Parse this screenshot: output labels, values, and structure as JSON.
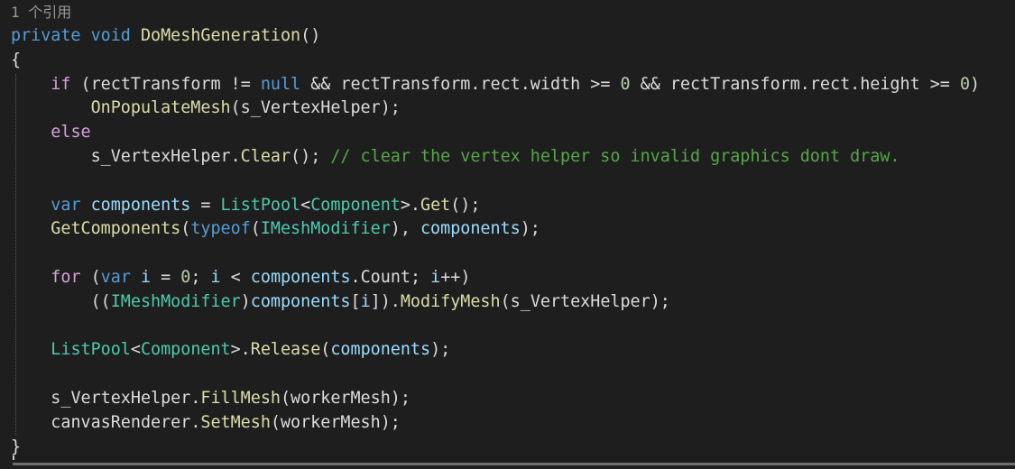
{
  "codelens": "1 个引用",
  "lines": [
    [
      {
        "text": "private",
        "c": "kw"
      },
      {
        "text": " ",
        "c": "plain"
      },
      {
        "text": "void",
        "c": "kw"
      },
      {
        "text": " ",
        "c": "plain"
      },
      {
        "text": "DoMeshGeneration",
        "c": "mth"
      },
      {
        "text": "()",
        "c": "plain"
      }
    ],
    [
      {
        "text": "{",
        "c": "plain"
      }
    ],
    [
      {
        "text": "    ",
        "c": "plain"
      },
      {
        "text": "if",
        "c": "ctl"
      },
      {
        "text": " (",
        "c": "plain"
      },
      {
        "text": "rectTransform",
        "c": "plain"
      },
      {
        "text": " != ",
        "c": "plain"
      },
      {
        "text": "null",
        "c": "kw"
      },
      {
        "text": " && ",
        "c": "plain"
      },
      {
        "text": "rectTransform.rect.width",
        "c": "plain"
      },
      {
        "text": " >= ",
        "c": "plain"
      },
      {
        "text": "0",
        "c": "num"
      },
      {
        "text": " && ",
        "c": "plain"
      },
      {
        "text": "rectTransform.rect.height",
        "c": "plain"
      },
      {
        "text": " >= ",
        "c": "plain"
      },
      {
        "text": "0",
        "c": "num"
      },
      {
        "text": ")",
        "c": "plain"
      }
    ],
    [
      {
        "text": "        ",
        "c": "plain"
      },
      {
        "text": "OnPopulateMesh",
        "c": "mth"
      },
      {
        "text": "(",
        "c": "plain"
      },
      {
        "text": "s_VertexHelper",
        "c": "plain"
      },
      {
        "text": ");",
        "c": "plain"
      }
    ],
    [
      {
        "text": "    ",
        "c": "plain"
      },
      {
        "text": "else",
        "c": "ctl"
      }
    ],
    [
      {
        "text": "        ",
        "c": "plain"
      },
      {
        "text": "s_VertexHelper",
        "c": "plain"
      },
      {
        "text": ".",
        "c": "plain"
      },
      {
        "text": "Clear",
        "c": "mth"
      },
      {
        "text": "(); ",
        "c": "plain"
      },
      {
        "text": "// clear the vertex helper so invalid graphics dont draw.",
        "c": "cmt"
      }
    ],
    [],
    [
      {
        "text": "    ",
        "c": "plain"
      },
      {
        "text": "var",
        "c": "kw"
      },
      {
        "text": " ",
        "c": "plain"
      },
      {
        "text": "components",
        "c": "id"
      },
      {
        "text": " = ",
        "c": "plain"
      },
      {
        "text": "ListPool",
        "c": "typ"
      },
      {
        "text": "<",
        "c": "plain"
      },
      {
        "text": "Component",
        "c": "typ"
      },
      {
        "text": ">.",
        "c": "plain"
      },
      {
        "text": "Get",
        "c": "mth"
      },
      {
        "text": "();",
        "c": "plain"
      }
    ],
    [
      {
        "text": "    ",
        "c": "plain"
      },
      {
        "text": "GetComponents",
        "c": "mth"
      },
      {
        "text": "(",
        "c": "plain"
      },
      {
        "text": "typeof",
        "c": "kw"
      },
      {
        "text": "(",
        "c": "plain"
      },
      {
        "text": "IMeshModifier",
        "c": "typ"
      },
      {
        "text": "), ",
        "c": "plain"
      },
      {
        "text": "components",
        "c": "id"
      },
      {
        "text": ");",
        "c": "plain"
      }
    ],
    [],
    [
      {
        "text": "    ",
        "c": "plain"
      },
      {
        "text": "for",
        "c": "ctl"
      },
      {
        "text": " (",
        "c": "plain"
      },
      {
        "text": "var",
        "c": "kw"
      },
      {
        "text": " ",
        "c": "plain"
      },
      {
        "text": "i",
        "c": "id"
      },
      {
        "text": " = ",
        "c": "plain"
      },
      {
        "text": "0",
        "c": "num"
      },
      {
        "text": "; ",
        "c": "plain"
      },
      {
        "text": "i",
        "c": "id"
      },
      {
        "text": " < ",
        "c": "plain"
      },
      {
        "text": "components",
        "c": "id"
      },
      {
        "text": ".Count; ",
        "c": "plain"
      },
      {
        "text": "i",
        "c": "id"
      },
      {
        "text": "++)",
        "c": "plain"
      }
    ],
    [
      {
        "text": "        ((",
        "c": "plain"
      },
      {
        "text": "IMeshModifier",
        "c": "typ"
      },
      {
        "text": ")",
        "c": "plain"
      },
      {
        "text": "components",
        "c": "id"
      },
      {
        "text": "[",
        "c": "plain"
      },
      {
        "text": "i",
        "c": "id"
      },
      {
        "text": "]).",
        "c": "plain"
      },
      {
        "text": "ModifyMesh",
        "c": "mth"
      },
      {
        "text": "(",
        "c": "plain"
      },
      {
        "text": "s_VertexHelper",
        "c": "plain"
      },
      {
        "text": ");",
        "c": "plain"
      }
    ],
    [],
    [
      {
        "text": "    ",
        "c": "plain"
      },
      {
        "text": "ListPool",
        "c": "typ"
      },
      {
        "text": "<",
        "c": "plain"
      },
      {
        "text": "Component",
        "c": "typ"
      },
      {
        "text": ">.",
        "c": "plain"
      },
      {
        "text": "Release",
        "c": "mth"
      },
      {
        "text": "(",
        "c": "plain"
      },
      {
        "text": "components",
        "c": "id"
      },
      {
        "text": ");",
        "c": "plain"
      }
    ],
    [],
    [
      {
        "text": "    ",
        "c": "plain"
      },
      {
        "text": "s_VertexHelper",
        "c": "plain"
      },
      {
        "text": ".",
        "c": "plain"
      },
      {
        "text": "FillMesh",
        "c": "mth"
      },
      {
        "text": "(",
        "c": "plain"
      },
      {
        "text": "workerMesh",
        "c": "plain"
      },
      {
        "text": ");",
        "c": "plain"
      }
    ],
    [
      {
        "text": "    ",
        "c": "plain"
      },
      {
        "text": "canvasRenderer",
        "c": "plain"
      },
      {
        "text": ".",
        "c": "plain"
      },
      {
        "text": "SetMesh",
        "c": "mth"
      },
      {
        "text": "(",
        "c": "plain"
      },
      {
        "text": "workerMesh",
        "c": "plain"
      },
      {
        "text": ");",
        "c": "plain"
      }
    ],
    [
      {
        "text": "}",
        "c": "plain"
      }
    ]
  ]
}
